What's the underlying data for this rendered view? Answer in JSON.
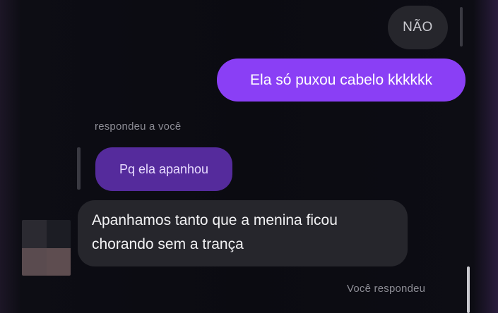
{
  "messages": {
    "received_short": "NÃO",
    "sent": "Ela só puxou cabelo kkkkkk",
    "reply_caption": "respondeu a você",
    "quoted": "Pq ela apanhou",
    "received_long_line1": "Apanhamos tanto que a menina ficou",
    "received_long_line2": "chorando sem a trança",
    "footer_status": "Você respondeu"
  },
  "colors": {
    "sent_bubble": "#8a3ff5",
    "quoted_bubble": "#552b9c",
    "received_bubble": "#26262c",
    "background": "#0b0b11",
    "caption_text": "#8c8c94"
  },
  "icons": {
    "avatar": "blurred-avatar-icon"
  }
}
